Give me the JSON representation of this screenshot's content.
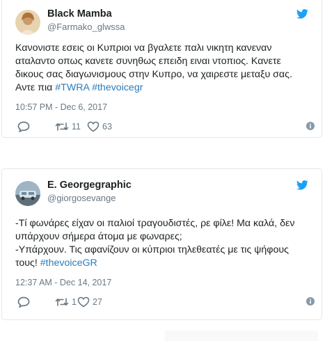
{
  "tweets": [
    {
      "name": "Black Mamba",
      "handle": "@Farmako_glwssa",
      "text_lines": [
        "Κανονιστε εσεις οι Κυπριοι να βγαλετε παλι νικητη κανεναν",
        "αταλαντο οπως κανετε συνηθως επειδη ειναι ντοπιος. Κανετε",
        "δικους σας διαγωνισμους στην Κυπρο, να χαιρεστε μεταξυ σας."
      ],
      "text_tail_prefix": "Αντε πια ",
      "hashtags": [
        "#TWRA",
        "#thevoicegr"
      ],
      "timestamp": "10:57 PM - Dec 6, 2017",
      "retweets": "11",
      "likes": "63"
    },
    {
      "name": "E. Georgegraphic",
      "handle": "@giorgosevange",
      "text_lines": [
        "-Τί φωνάρες είχαν οι παλιοί τραγουδιστές, ρε φίλε! Μα καλά, δεν",
        "υπάρχουν σήμερα άτομα με φωναρες;",
        "-Υπάρχουν. Τις αφανίζουν οι κύπριοι τηλεθεατές με τις ψήφους"
      ],
      "text_tail_prefix": "τους! ",
      "hashtags": [
        "#thevoiceGR"
      ],
      "timestamp": "12:37 AM - Dec 14, 2017",
      "retweets": "1",
      "likes": "27"
    }
  ],
  "colors": {
    "twitter_blue": "#1da1f2",
    "link": "#2b7bb9",
    "muted": "#697882",
    "like_red": "#e0245e"
  },
  "icons": [
    "twitter-bird-icon",
    "reply-icon",
    "retweet-icon",
    "heart-icon",
    "info-icon"
  ]
}
